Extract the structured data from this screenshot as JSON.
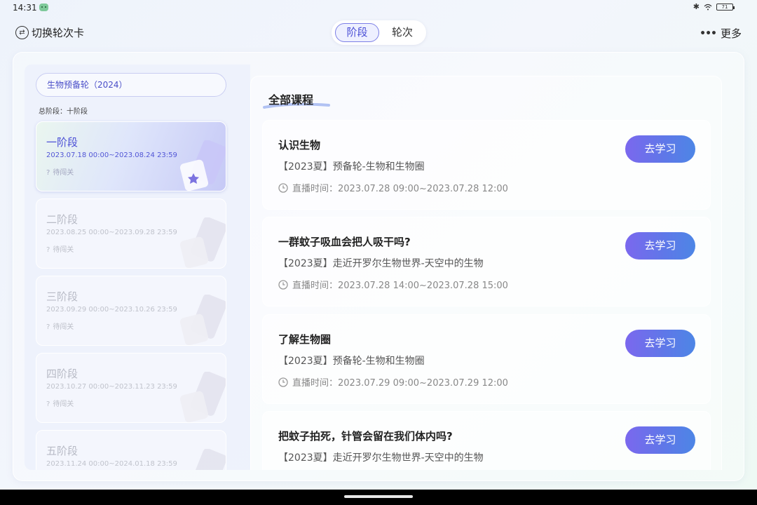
{
  "status_bar": {
    "time": "14:31",
    "battery": "71"
  },
  "header": {
    "switch_label": "切换轮次卡",
    "tabs": [
      {
        "label": "阶段",
        "active": true
      },
      {
        "label": "轮次",
        "active": false
      }
    ],
    "more_label": "更多"
  },
  "sidebar": {
    "course_name": "生物预备轮（2024）",
    "total_stages": "总阶段：十阶段",
    "stages": [
      {
        "title": "一阶段",
        "date": "2023.07.18 00:00~2023.08.24 23:59",
        "status": "待闯关",
        "status_icon": "?",
        "active": true
      },
      {
        "title": "二阶段",
        "date": "2023.08.25 00:00~2023.09.28 23:59",
        "status": "待闯关",
        "status_icon": "?",
        "active": false
      },
      {
        "title": "三阶段",
        "date": "2023.09.29 00:00~2023.10.26 23:59",
        "status": "待闯关",
        "status_icon": "?",
        "active": false
      },
      {
        "title": "四阶段",
        "date": "2023.10.27 00:00~2023.11.23 23:59",
        "status": "待闯关",
        "status_icon": "?",
        "active": false
      },
      {
        "title": "五阶段",
        "date": "2023.11.24 00:00~2024.01.18 23:59",
        "status": "",
        "status_icon": "",
        "active": false
      }
    ]
  },
  "main": {
    "section_title": "全部课程",
    "lessons": [
      {
        "title": "认识生物",
        "course": "【2023夏】预备轮-生物和生物圈",
        "time": "直播时间：2023.07.28 09:00~2023.07.28 12:00",
        "button": "去学习"
      },
      {
        "title": "一群蚊子吸血会把人吸干吗?",
        "course": "【2023夏】走近开罗尔生物世界-天空中的生物",
        "time": "直播时间：2023.07.28 14:00~2023.07.28 15:00",
        "button": "去学习"
      },
      {
        "title": "了解生物圈",
        "course": "【2023夏】预备轮-生物和生物圈",
        "time": "直播时间：2023.07.29 09:00~2023.07.29 12:00",
        "button": "去学习"
      },
      {
        "title": "把蚊子拍死，针管会留在我们体内吗?",
        "course": "【2023夏】走近开罗尔生物世界-天空中的生物",
        "time": "",
        "button": "去学习"
      }
    ]
  },
  "colors": {
    "accent": "#4b4fd6",
    "button_start": "#7b68ee",
    "button_end": "#4d86e6"
  }
}
